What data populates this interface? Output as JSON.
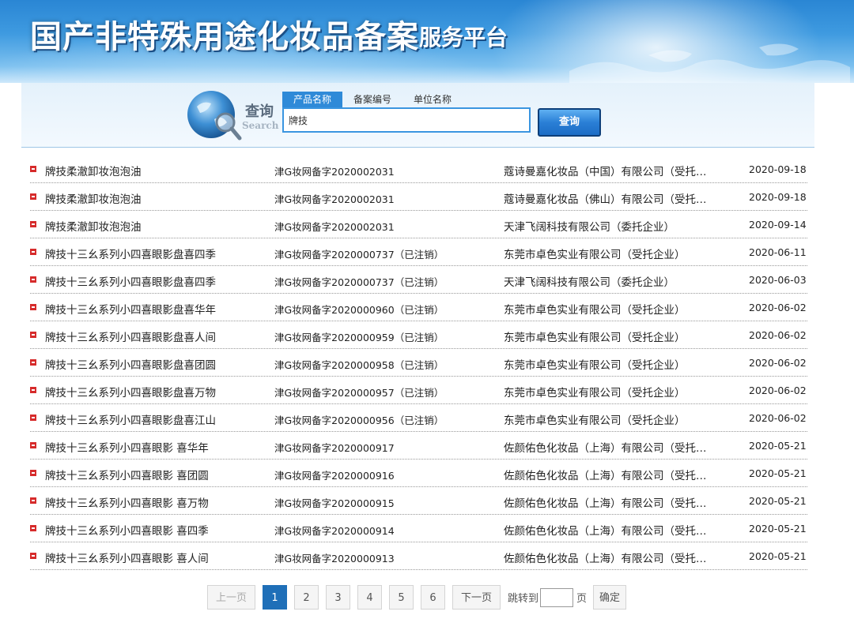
{
  "header": {
    "title": "国产非特殊用途化妆品备案",
    "subtitle": "服务平台"
  },
  "search": {
    "label_cn": "查询",
    "label_en": "Search",
    "tabs": [
      "产品名称",
      "备案编号",
      "单位名称"
    ],
    "active_tab": "产品名称",
    "query": "牌技",
    "button": "查询"
  },
  "results": [
    {
      "name": "牌技柔澈卸妆泡泡油",
      "record_no": "津G妆网备字2020002031",
      "company": "蔻诗曼嘉化妆品（中国）有限公司（受托…",
      "date": "2020-09-18"
    },
    {
      "name": "牌技柔澈卸妆泡泡油",
      "record_no": "津G妆网备字2020002031",
      "company": "蔻诗曼嘉化妆品（佛山）有限公司（受托…",
      "date": "2020-09-18"
    },
    {
      "name": "牌技柔澈卸妆泡泡油",
      "record_no": "津G妆网备字2020002031",
      "company": "天津飞阔科技有限公司（委托企业）",
      "date": "2020-09-14"
    },
    {
      "name": "牌技十三幺系列小四喜眼影盘喜四季",
      "record_no": "津G妆网备字2020000737（已注销）",
      "company": "东莞市卓色实业有限公司（受托企业）",
      "date": "2020-06-11"
    },
    {
      "name": "牌技十三幺系列小四喜眼影盘喜四季",
      "record_no": "津G妆网备字2020000737（已注销）",
      "company": "天津飞阔科技有限公司（委托企业）",
      "date": "2020-06-03"
    },
    {
      "name": "牌技十三幺系列小四喜眼影盘喜华年",
      "record_no": "津G妆网备字2020000960（已注销）",
      "company": "东莞市卓色实业有限公司（受托企业）",
      "date": "2020-06-02"
    },
    {
      "name": "牌技十三幺系列小四喜眼影盘喜人间",
      "record_no": "津G妆网备字2020000959（已注销）",
      "company": "东莞市卓色实业有限公司（受托企业）",
      "date": "2020-06-02"
    },
    {
      "name": "牌技十三幺系列小四喜眼影盘喜团圆",
      "record_no": "津G妆网备字2020000958（已注销）",
      "company": "东莞市卓色实业有限公司（受托企业）",
      "date": "2020-06-02"
    },
    {
      "name": "牌技十三幺系列小四喜眼影盘喜万物",
      "record_no": "津G妆网备字2020000957（已注销）",
      "company": "东莞市卓色实业有限公司（受托企业）",
      "date": "2020-06-02"
    },
    {
      "name": "牌技十三幺系列小四喜眼影盘喜江山",
      "record_no": "津G妆网备字2020000956（已注销）",
      "company": "东莞市卓色实业有限公司（受托企业）",
      "date": "2020-06-02"
    },
    {
      "name": "牌技十三幺系列小四喜眼影 喜华年",
      "record_no": "津G妆网备字2020000917",
      "company": "佐颜佑色化妆品（上海）有限公司（受托…",
      "date": "2020-05-21"
    },
    {
      "name": "牌技十三幺系列小四喜眼影 喜团圆",
      "record_no": "津G妆网备字2020000916",
      "company": "佐颜佑色化妆品（上海）有限公司（受托…",
      "date": "2020-05-21"
    },
    {
      "name": "牌技十三幺系列小四喜眼影 喜万物",
      "record_no": "津G妆网备字2020000915",
      "company": "佐颜佑色化妆品（上海）有限公司（受托…",
      "date": "2020-05-21"
    },
    {
      "name": "牌技十三幺系列小四喜眼影 喜四季",
      "record_no": "津G妆网备字2020000914",
      "company": "佐颜佑色化妆品（上海）有限公司（受托…",
      "date": "2020-05-21"
    },
    {
      "name": "牌技十三幺系列小四喜眼影 喜人间",
      "record_no": "津G妆网备字2020000913",
      "company": "佐颜佑色化妆品（上海）有限公司（受托…",
      "date": "2020-05-21"
    }
  ],
  "pagination": {
    "prev": "上一页",
    "pages": [
      "1",
      "2",
      "3",
      "4",
      "5",
      "6"
    ],
    "current": "1",
    "next": "下一页",
    "jump_label": "跳转到",
    "page_unit": "页",
    "confirm": "确定"
  },
  "colors": {
    "accent": "#2f8ad8",
    "active_page": "#1f6fb8",
    "bullet": "#d62b2b"
  }
}
